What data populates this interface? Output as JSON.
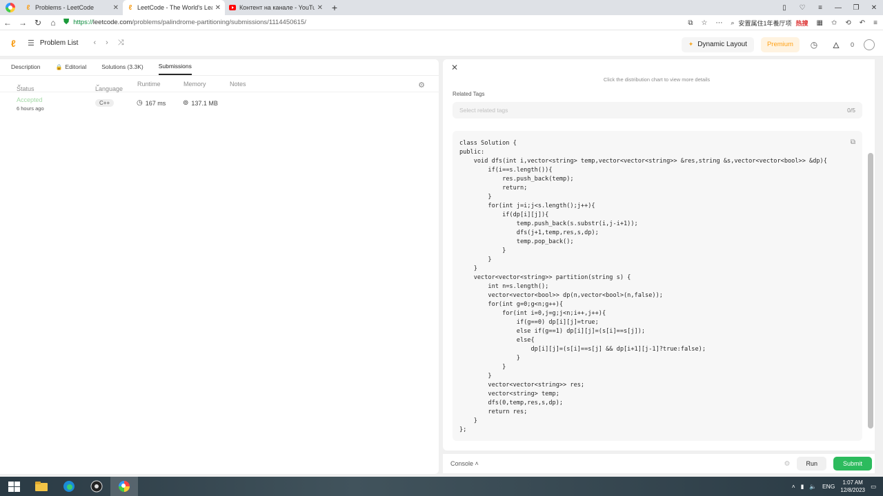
{
  "browser": {
    "tabs": [
      {
        "title": "Problems - LeetCode",
        "active": false,
        "favicon": "leetcode"
      },
      {
        "title": "LeetCode - The World's Leadi",
        "active": true,
        "favicon": "leetcode"
      },
      {
        "title": "Контент на канале - YouTube",
        "active": false,
        "favicon": "youtube"
      }
    ],
    "url": {
      "proto": "https://",
      "host": "leetcode.com",
      "path": "/problems/palindrome-partitioning/submissions/1114450615/"
    },
    "search_text": "安置属住1年養厅项",
    "hot_label": "热搜"
  },
  "header": {
    "problem_list": "Problem List",
    "dynamic_layout": "Dynamic Layout",
    "premium": "Premium",
    "fire_count": "0"
  },
  "left": {
    "tabs": [
      "Description",
      "Editorial",
      "Solutions (3.3K)",
      "Submissions"
    ],
    "columns": {
      "status": "Status",
      "language": "Language",
      "runtime": "Runtime",
      "memory": "Memory",
      "notes": "Notes"
    },
    "submission": {
      "status": "Accepted",
      "time_ago": "6 hours ago",
      "language": "C++",
      "runtime": "167 ms",
      "memory": "137.1 MB"
    }
  },
  "right": {
    "chart_hint": "Click the distribution chart to view more details",
    "related_tags_label": "Related Tags",
    "related_tags_placeholder": "Select related tags",
    "related_tags_count": "0/5",
    "code_lines": [
      "class Solution {",
      "public:",
      "    void dfs(int i,vector<string> temp,vector<vector<string>> &res,string &s,vector<vector<bool>> &dp){",
      "        if(i==s.length()){",
      "            res.push_back(temp);",
      "            return;",
      "        }",
      "        for(int j=i;j<s.length();j++){",
      "            if(dp[i][j]){",
      "                temp.push_back(s.substr(i,j-i+1));",
      "                dfs(j+1,temp,res,s,dp);",
      "                temp.pop_back();",
      "            }",
      "        }",
      "    }",
      "    vector<vector<string>> partition(string s) {",
      "        int n=s.length();",
      "        vector<vector<bool>> dp(n,vector<bool>(n,false));",
      "        for(int g=0;g<n;g++){",
      "            for(int i=0,j=g;j<n;i++,j++){",
      "                if(g==0) dp[i][j]=true;",
      "                else if(g==1) dp[i][j]=(s[i]==s[j]);",
      "                else{",
      "                    dp[i][j]=(s[i]==s[j] && dp[i+1][j-1]?true:false);",
      "                }",
      "            }",
      "        }",
      "        vector<vector<string>> res;",
      "        vector<string> temp;",
      "        dfs(0,temp,res,s,dp);",
      "        return res;",
      "    }",
      "};"
    ]
  },
  "bottom": {
    "console": "Console",
    "run": "Run",
    "submit": "Submit"
  },
  "taskbar": {
    "lang": "ENG",
    "time": "1:07 AM",
    "date": "12/8/2023"
  }
}
